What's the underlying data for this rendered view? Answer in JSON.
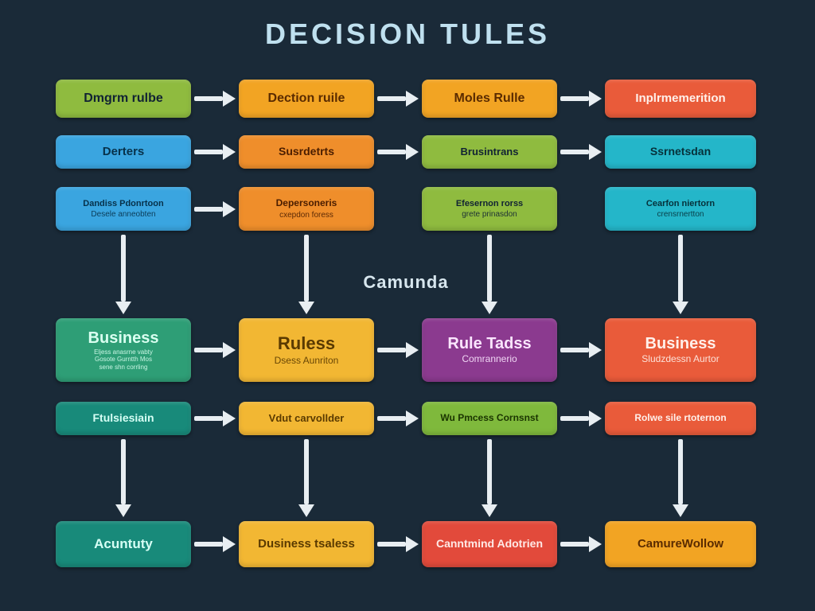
{
  "title": "DECISION TULES",
  "center_label": "Camunda",
  "colors": {
    "bg": "#1a2a38",
    "arrow": "#e8eef2"
  },
  "boxes": {
    "r1c1": {
      "label": "Dmgrm rulbe",
      "sub": "",
      "color": "olive"
    },
    "r1c2": {
      "label": "Dection ruile",
      "sub": "",
      "color": "orange"
    },
    "r1c3": {
      "label": "Moles Rulle",
      "sub": "",
      "color": "orange"
    },
    "r1c4": {
      "label": "Inplrmemerition",
      "sub": "",
      "color": "tomato"
    },
    "r2c1": {
      "label": "Derters",
      "sub": "",
      "color": "blue"
    },
    "r2c2": {
      "label": "Susrdetrts",
      "sub": "",
      "color": "orange2"
    },
    "r2c3": {
      "label": "Brusintrans",
      "sub": "",
      "color": "olive"
    },
    "r2c4": {
      "label": "Ssrnetsdan",
      "sub": "",
      "color": "cyan"
    },
    "r3c1": {
      "label": "Dandiss Pdonrtoon",
      "sub": "Desele anneobten",
      "color": "blue"
    },
    "r3c2": {
      "label": "Depersoneris",
      "sub": "cxepdon foress",
      "color": "orange2"
    },
    "r3c3": {
      "label": "Efesernon rorss",
      "sub": "grete prinasdon",
      "color": "olive"
    },
    "r3c4": {
      "label": "Cearfon niertorn",
      "sub": "crensrnertton",
      "color": "cyan"
    },
    "r4c1": {
      "label": "Business",
      "sub": "Eljess anasrne vabty\\nGosote Gurntth Mos\\nsene shn corrling",
      "color": "green"
    },
    "r4c2": {
      "label": "Ruless",
      "sub": "Dsess Aunriton",
      "color": "yellow"
    },
    "r4c3": {
      "label": "Rule Tadss",
      "sub": "Comrannerio",
      "color": "purple"
    },
    "r4c4": {
      "label": "Business",
      "sub": "Sludzdessn Aurtor",
      "color": "tomato"
    },
    "r5c1": {
      "label": "Ftulsiesiain",
      "sub": "",
      "color": "teal"
    },
    "r5c2": {
      "label": "Vdut carvollder",
      "sub": "",
      "color": "yellow"
    },
    "r5c3": {
      "label": "Wu Pmcess Cornsnst",
      "sub": "",
      "color": "limebox"
    },
    "r5c4": {
      "label": "Rolwe sile rtoternon",
      "sub": "",
      "color": "tomato"
    },
    "r6c1": {
      "label": "Acuntuty",
      "sub": "",
      "color": "teal"
    },
    "r6c2": {
      "label": "Dusiness tsaless",
      "sub": "",
      "color": "yellow"
    },
    "r6c3": {
      "label": "Canntmind Adotrien",
      "sub": "",
      "color": "red"
    },
    "r6c4": {
      "label": "CamureWollow",
      "sub": "",
      "color": "orange"
    }
  }
}
